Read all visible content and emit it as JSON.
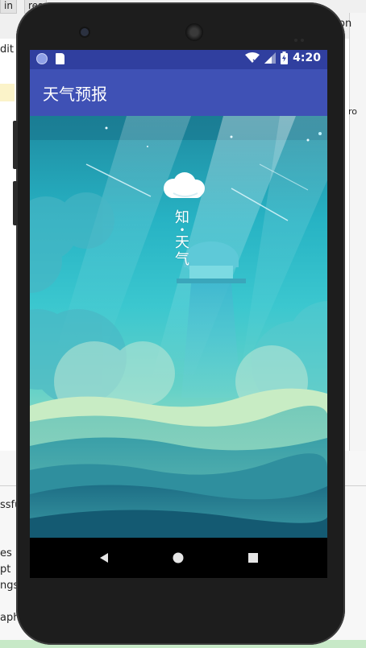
{
  "ide": {
    "tab1": "in",
    "tab2": "res",
    "left_fragments": [
      "dit",
      "ssfu",
      "es",
      "pt",
      "ngs",
      "aph"
    ],
    "right_fragments": [
      "on",
      "ro"
    ]
  },
  "status_bar": {
    "time": "4:20",
    "icons": [
      "circle-notification-icon",
      "sd-card-icon",
      "wifi-icon",
      "signal-icon",
      "battery-icon"
    ]
  },
  "app": {
    "title": "天气预报"
  },
  "splash": {
    "logo_text": [
      "知",
      "•",
      "天",
      "气"
    ]
  },
  "nav": {
    "buttons": [
      "back",
      "home",
      "recents"
    ]
  },
  "colors": {
    "status_bar": "#303f9f",
    "app_bar": "#3f51b5"
  }
}
